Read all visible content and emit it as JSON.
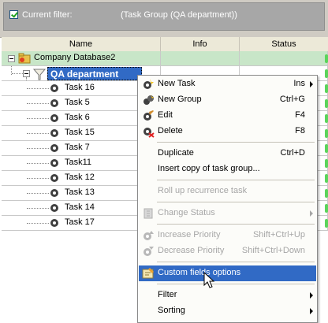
{
  "filter": {
    "label": "Current filter:",
    "value": "(Task Group  (QA department))"
  },
  "columns": [
    "Name",
    "Info",
    "Status"
  ],
  "tree": {
    "root": "Company Database2",
    "group": "QA department",
    "tasks": [
      "Task 16",
      "Task 5",
      "Task 6",
      "Task 15",
      "Task 7",
      "Task11",
      "Task 12",
      "Task 13",
      "Task 14",
      "Task 17"
    ]
  },
  "menu": {
    "new_task": "New Task",
    "new_task_sc": "Ins",
    "new_group": "New Group",
    "new_group_sc": "Ctrl+G",
    "edit": "Edit",
    "edit_sc": "F4",
    "delete": "Delete",
    "delete_sc": "F8",
    "duplicate": "Duplicate",
    "duplicate_sc": "Ctrl+D",
    "insert_copy": "Insert copy of task group...",
    "roll_up": "Roll up recurrence task",
    "change_status": "Change Status",
    "inc_priority": "Increase Priority",
    "inc_priority_sc": "Shift+Ctrl+Up",
    "dec_priority": "Decrease Priority",
    "dec_priority_sc": "Shift+Ctrl+Down",
    "custom_fields": "Custom fields options",
    "filter": "Filter",
    "sorting": "Sorting"
  },
  "colors": {
    "selection": "#316ac5",
    "db_row": "#c8e6c8",
    "status_green": "#5bd45b"
  }
}
